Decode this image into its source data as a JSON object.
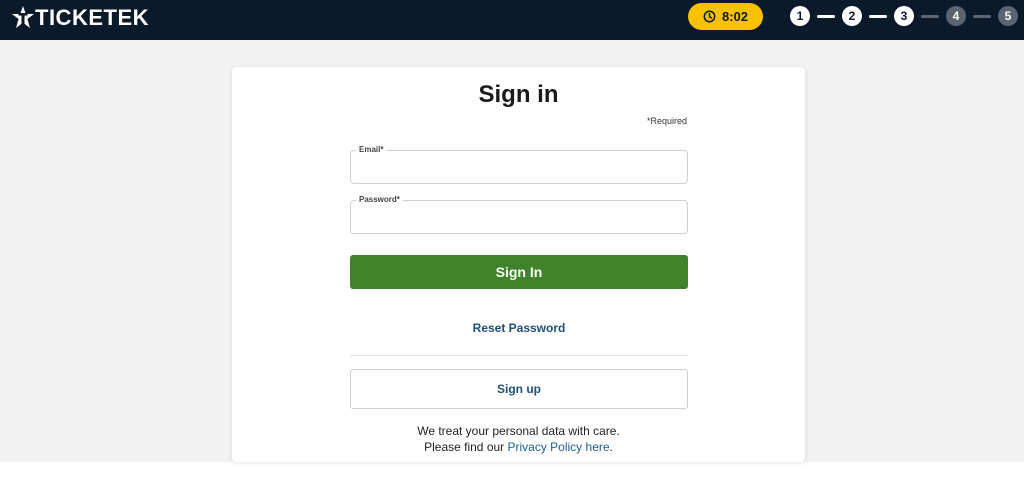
{
  "header": {
    "logo_text": "TICKETEK",
    "timer": "8:02",
    "timer_icon": "clock-icon",
    "steps": [
      {
        "label": "1",
        "state": "active"
      },
      {
        "label": "2",
        "state": "active"
      },
      {
        "label": "3",
        "state": "active"
      },
      {
        "label": "4",
        "state": "inactive"
      },
      {
        "label": "5",
        "state": "inactive"
      }
    ],
    "colors": {
      "bar": "#0a1a2a",
      "timer": "#f9c100"
    }
  },
  "form": {
    "title": "Sign in",
    "required_note": "*Required",
    "email_label": "Email*",
    "email_value": "",
    "password_label": "Password*",
    "password_value": "",
    "signin_label": "Sign In",
    "reset_label": "Reset Password",
    "signup_label": "Sign up",
    "privacy_line1": "We treat your personal data with care.",
    "privacy_line2_prefix": "Please find our ",
    "privacy_link": "Privacy Policy here",
    "privacy_line2_suffix": ".",
    "colors": {
      "primary_button": "#41832a",
      "link": "#1e4e79"
    }
  }
}
